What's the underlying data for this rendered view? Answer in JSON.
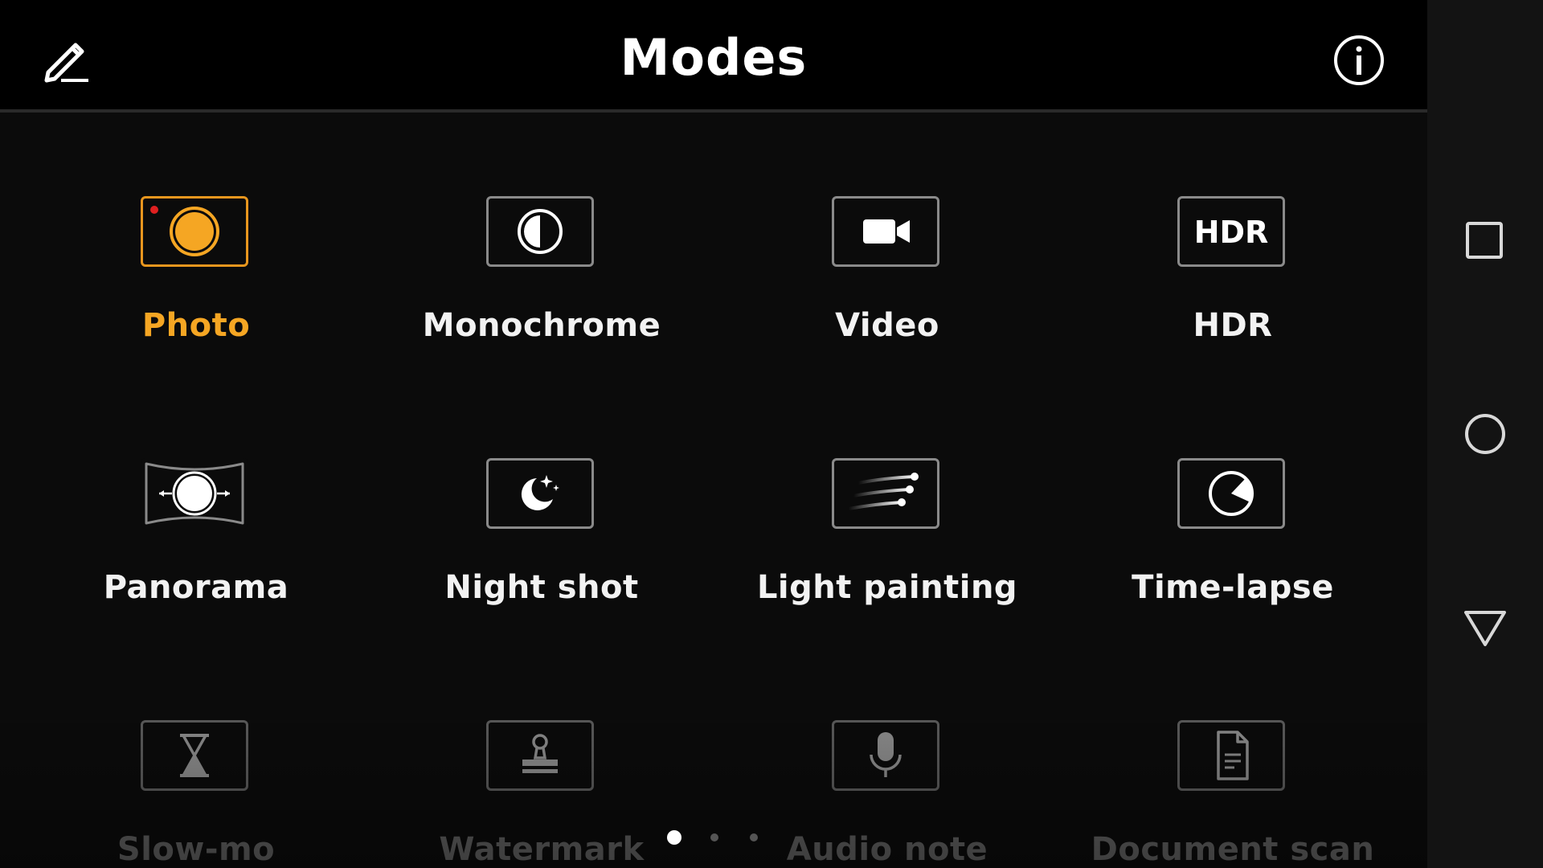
{
  "header": {
    "title": "Modes",
    "edit_icon": "pencil-icon",
    "info_icon": "info-icon"
  },
  "modes": [
    {
      "label": "Photo",
      "icon": "photo-shutter-icon",
      "active": true
    },
    {
      "label": "Monochrome",
      "icon": "monochrome-icon",
      "active": false
    },
    {
      "label": "Video",
      "icon": "video-camera-icon",
      "active": false
    },
    {
      "label": "HDR",
      "icon": "hdr-icon",
      "icon_text": "HDR",
      "active": false
    },
    {
      "label": "Panorama",
      "icon": "panorama-icon",
      "active": false
    },
    {
      "label": "Night shot",
      "icon": "night-moon-icon",
      "active": false
    },
    {
      "label": "Light painting",
      "icon": "light-trails-icon",
      "active": false
    },
    {
      "label": "Time-lapse",
      "icon": "timelapse-icon",
      "active": false
    },
    {
      "label": "Slow-mo",
      "icon": "hourglass-icon",
      "active": false
    },
    {
      "label": "Watermark",
      "icon": "stamp-icon",
      "active": false
    },
    {
      "label": "Audio note",
      "icon": "microphone-icon",
      "active": false
    },
    {
      "label": "Document scan",
      "icon": "document-icon",
      "active": false
    }
  ],
  "pagination": {
    "pages": 3,
    "current": 1
  },
  "navbar": {
    "recents_icon": "square-recents-icon",
    "home_icon": "circle-home-icon",
    "back_icon": "triangle-back-icon"
  },
  "colors": {
    "accent": "#f5a623",
    "accent_border": "#e8961e",
    "record_dot": "#e02020",
    "text": "#f2f2f2",
    "background": "#0b0b0b"
  }
}
